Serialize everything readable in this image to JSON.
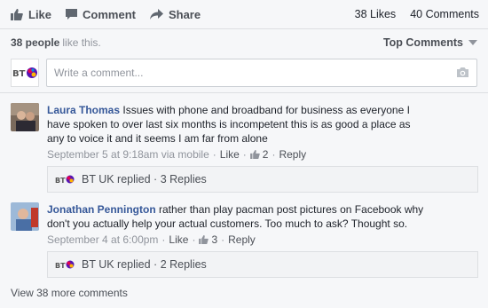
{
  "actions": {
    "like_label": "Like",
    "comment_label": "Comment",
    "share_label": "Share",
    "likes_count": "38 Likes",
    "comments_count": "40 Comments"
  },
  "summary": {
    "people": "38 people",
    "like_text": "like this.",
    "top_comments_label": "Top Comments"
  },
  "composer": {
    "placeholder": "Write a comment..."
  },
  "comments": [
    {
      "author": "Laura Thomas",
      "text": "Issues with phone and broadband for business as everyone I have spoken to over last six months is incompetent this is as good a place as any to voice it and it seems I am far from alone",
      "timestamp": "September 5 at 9:18am via mobile",
      "like_label": "Like",
      "like_count": "2",
      "reply_label": "Reply",
      "replies_summary": "BT UK replied · 3 Replies"
    },
    {
      "author": "Jonathan Pennington",
      "text": "rather than play pacman post pictures on Facebook why don't you actually help your actual customers. Too much to ask? Thought so.",
      "timestamp": "September 4 at 6:00pm",
      "like_label": "Like",
      "like_count": "3",
      "reply_label": "Reply",
      "replies_summary": "BT UK replied · 2 Replies"
    }
  ],
  "view_more": "View 38 more comments",
  "brand": {
    "bt_text": "BT",
    "accent": "#365899",
    "bt_blue": "#5514b4"
  }
}
